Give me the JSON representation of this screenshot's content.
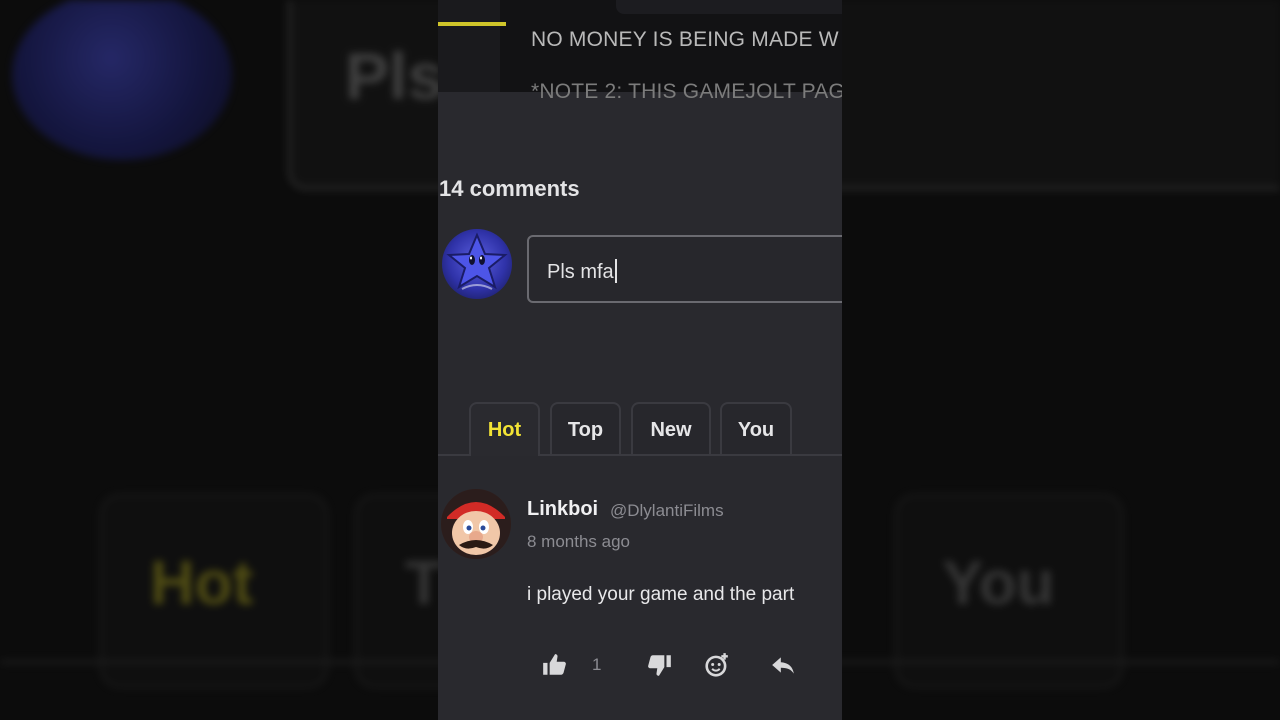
{
  "description": {
    "line1": "NO MONEY IS BEING MADE W",
    "line2": "*NOTE 2: THIS GAMEJOLT PAG"
  },
  "comments": {
    "count_label": "14 comments",
    "input_value": "Pls mfa",
    "tabs": [
      {
        "label": "Hot",
        "active": true
      },
      {
        "label": "Top",
        "active": false
      },
      {
        "label": "New",
        "active": false
      },
      {
        "label": "You",
        "active": false
      }
    ],
    "items": [
      {
        "author": "Linkboi",
        "handle": "@DlylantiFilms",
        "time": "8 months ago",
        "body": "i played your game and the part",
        "likes": "1"
      }
    ]
  },
  "backdrop": {
    "input_text": "Pls",
    "tabs": [
      "Hot",
      "T",
      "You"
    ]
  },
  "colors": {
    "accent_yellow": "#f2e335",
    "panel_bg": "#29292e",
    "page_bg": "#0c0c0c"
  },
  "icons": [
    "thumbs-up-icon",
    "thumbs-down-icon",
    "sticker-icon",
    "reply-icon"
  ]
}
